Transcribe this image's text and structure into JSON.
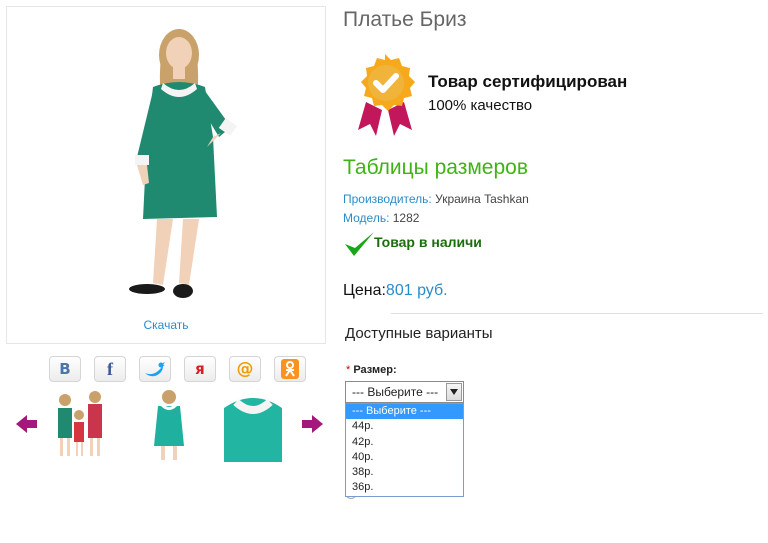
{
  "product": {
    "title": "Платье Бриз",
    "download_link": "Скачать"
  },
  "certificate": {
    "title": "Товар сертифицирован",
    "subtitle": "100% качество",
    "icon": "certificate-badge-icon"
  },
  "size_table_link": "Таблицы размеров",
  "meta": {
    "manufacturer_label": "Производитель:",
    "manufacturer_value": "Украина Tashkan",
    "model_label": "Модель:",
    "model_value": "1282"
  },
  "stock": {
    "text": "Товар в наличи"
  },
  "price": {
    "label": "Цена:",
    "value": "801 руб."
  },
  "options": {
    "title": "Доступные варианты",
    "size_required_mark": "*",
    "size_label": "Размер:",
    "selected": "--- Выберите ---",
    "items": [
      "--- Выберите ---",
      "44р.",
      "42р.",
      "40р.",
      "38р.",
      "36р."
    ]
  },
  "social": [
    {
      "name": "vk-share-button",
      "glyph": "В",
      "color": "#4a76a8"
    },
    {
      "name": "facebook-share-button",
      "glyph": "f",
      "color": "#3b5998"
    },
    {
      "name": "twitter-share-button",
      "glyph": "tw",
      "color": "#1da1f2"
    },
    {
      "name": "yaru-share-button",
      "glyph": "я",
      "color": "#d61f26"
    },
    {
      "name": "mailru-share-button",
      "glyph": "@",
      "color": "#f59a00"
    },
    {
      "name": "odnoklassniki-share-button",
      "glyph": "ok",
      "color": "#f7931e"
    }
  ],
  "colors": {
    "accent_blue": "#2a8cc7",
    "green": "#3fb316",
    "arrow_purple": "#a3187a"
  }
}
